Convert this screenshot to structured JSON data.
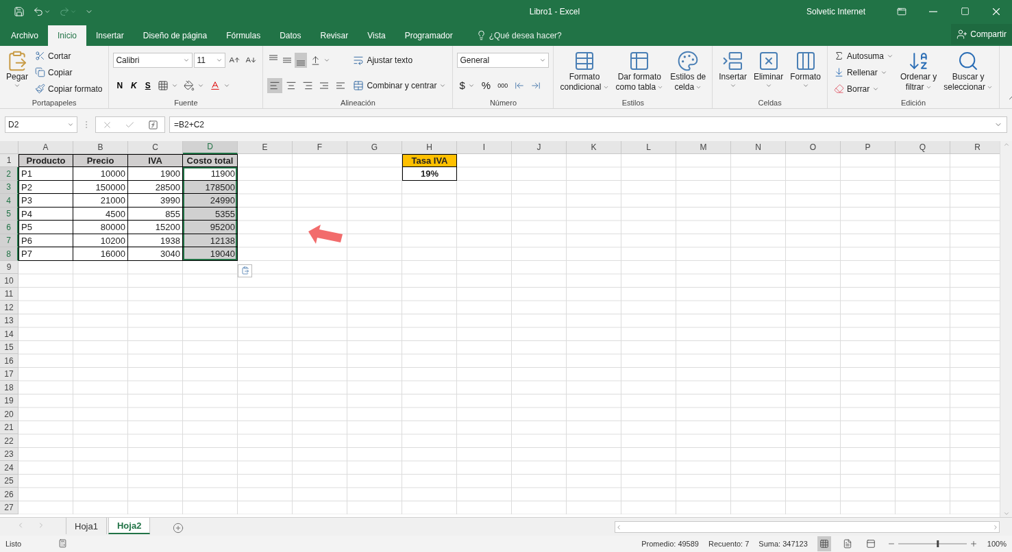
{
  "title_bar": {
    "title": "Libro1  -  Excel",
    "user": "Solvetic Internet"
  },
  "menu_tabs": [
    {
      "label": "Archivo",
      "selected": false
    },
    {
      "label": "Inicio",
      "selected": true
    },
    {
      "label": "Insertar",
      "selected": false
    },
    {
      "label": "Diseño de página",
      "selected": false
    },
    {
      "label": "Fórmulas",
      "selected": false
    },
    {
      "label": "Datos",
      "selected": false
    },
    {
      "label": "Revisar",
      "selected": false
    },
    {
      "label": "Vista",
      "selected": false
    },
    {
      "label": "Programador",
      "selected": false
    }
  ],
  "tell_me": "¿Qué desea hacer?",
  "share": "Compartir",
  "ribbon": {
    "clipboard": {
      "label": "Portapapeles",
      "paste": "Pegar",
      "items": [
        "Cortar",
        "Copiar",
        "Copiar formato"
      ]
    },
    "font": {
      "label": "Fuente",
      "font": "Calibri",
      "size": "11",
      "bold": "N",
      "italic": "K",
      "underline": "S"
    },
    "alignment": {
      "label": "Alineación",
      "wrap": "Ajustar texto",
      "merge": "Combinar y centrar",
      "vertical": [
        {
          "selected": false
        },
        {
          "selected": false
        },
        {
          "selected": true
        }
      ],
      "horizontal": [
        {
          "selected": true
        },
        {
          "selected": false
        },
        {
          "selected": false
        }
      ]
    },
    "number": {
      "label": "Número",
      "format": "General",
      "currency": "$",
      "percent": "%",
      "thousands": "000"
    },
    "styles": {
      "label": "Estilos",
      "buttons": [
        [
          "Formato",
          "condicional"
        ],
        [
          "Dar formato",
          "como tabla"
        ],
        [
          "Estilos de",
          "celda"
        ]
      ]
    },
    "cells": {
      "label": "Celdas",
      "buttons": [
        "Insertar",
        "Eliminar",
        "Formato"
      ]
    },
    "editing": {
      "label": "Edición",
      "items": [
        "Autosuma",
        "Rellenar",
        "Borrar"
      ],
      "buttons": [
        [
          "Ordenar y",
          "filtrar"
        ],
        [
          "Buscar y",
          "seleccionar"
        ]
      ]
    }
  },
  "formula_bar": {
    "name_box": "D2",
    "formula": "=B2+C2"
  },
  "columns": [
    {
      "label": "A",
      "selected": false
    },
    {
      "label": "B",
      "selected": false
    },
    {
      "label": "C",
      "selected": false
    },
    {
      "label": "D",
      "selected": true
    },
    {
      "label": "E",
      "selected": false
    },
    {
      "label": "F",
      "selected": false
    },
    {
      "label": "G",
      "selected": false
    },
    {
      "label": "H",
      "selected": false
    },
    {
      "label": "I",
      "selected": false
    },
    {
      "label": "J",
      "selected": false
    },
    {
      "label": "K",
      "selected": false
    },
    {
      "label": "L",
      "selected": false
    },
    {
      "label": "M",
      "selected": false
    },
    {
      "label": "N",
      "selected": false
    },
    {
      "label": "O",
      "selected": false
    },
    {
      "label": "P",
      "selected": false
    },
    {
      "label": "Q",
      "selected": false
    },
    {
      "label": "R",
      "selected": false
    }
  ],
  "row_headers": [
    {
      "label": "1",
      "selected": false
    },
    {
      "label": "2",
      "selected": true
    },
    {
      "label": "3",
      "selected": true
    },
    {
      "label": "4",
      "selected": true
    },
    {
      "label": "5",
      "selected": true
    },
    {
      "label": "6",
      "selected": true
    },
    {
      "label": "7",
      "selected": true
    },
    {
      "label": "8",
      "selected": true
    },
    {
      "label": "9",
      "selected": false
    },
    {
      "label": "10",
      "selected": false
    },
    {
      "label": "11",
      "selected": false
    },
    {
      "label": "12",
      "selected": false
    },
    {
      "label": "13",
      "selected": false
    },
    {
      "label": "14",
      "selected": false
    },
    {
      "label": "15",
      "selected": false
    },
    {
      "label": "16",
      "selected": false
    },
    {
      "label": "17",
      "selected": false
    },
    {
      "label": "18",
      "selected": false
    },
    {
      "label": "19",
      "selected": false
    },
    {
      "label": "20",
      "selected": false
    },
    {
      "label": "21",
      "selected": false
    },
    {
      "label": "22",
      "selected": false
    },
    {
      "label": "23",
      "selected": false
    },
    {
      "label": "24",
      "selected": false
    },
    {
      "label": "25",
      "selected": false
    },
    {
      "label": "26",
      "selected": false
    },
    {
      "label": "27",
      "selected": false
    }
  ],
  "table": {
    "header": [
      "Producto",
      "Precio",
      "IVA",
      "Costo total"
    ],
    "rows": [
      {
        "cells": [
          "P1",
          "10000",
          "1900",
          "11900"
        ],
        "selected": true,
        "active": true
      },
      {
        "cells": [
          "P2",
          "150000",
          "28500",
          "178500"
        ],
        "selected": true,
        "active": false
      },
      {
        "cells": [
          "P3",
          "21000",
          "3990",
          "24990"
        ],
        "selected": true,
        "active": false
      },
      {
        "cells": [
          "P4",
          "4500",
          "855",
          "5355"
        ],
        "selected": true,
        "active": false
      },
      {
        "cells": [
          "P5",
          "80000",
          "15200",
          "95200"
        ],
        "selected": true,
        "active": false
      },
      {
        "cells": [
          "P6",
          "10200",
          "1938",
          "12138"
        ],
        "selected": true,
        "active": false
      },
      {
        "cells": [
          "P7",
          "16000",
          "3040",
          "19040"
        ],
        "selected": true,
        "active": false
      }
    ]
  },
  "rate_box": {
    "header": "Tasa IVA",
    "value": "19%"
  },
  "sheet_tabs": [
    {
      "label": "Hoja1",
      "selected": false
    },
    {
      "label": "Hoja2",
      "selected": true
    }
  ],
  "status_bar": {
    "mode": "Listo",
    "average": "Promedio: 49589",
    "count": "Recuento: 7",
    "sum": "Suma: 347123",
    "zoom": "100%",
    "zoom_slider": {
      "level": 0.58
    }
  }
}
